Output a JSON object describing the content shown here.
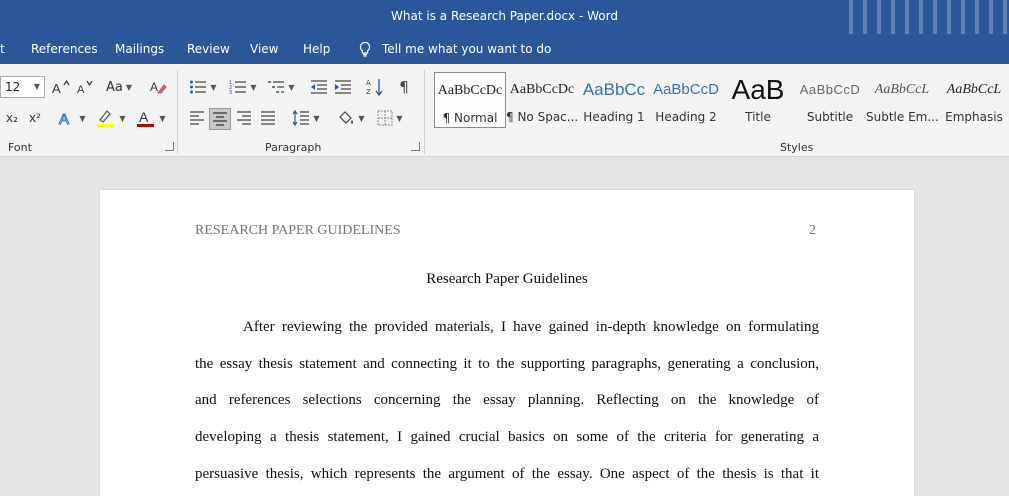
{
  "window": {
    "title": "What is a Research Paper.docx  -  Word"
  },
  "tabs": [
    {
      "label": "t"
    },
    {
      "label": "References"
    },
    {
      "label": "Mailings"
    },
    {
      "label": "Review"
    },
    {
      "label": "View"
    },
    {
      "label": "Help"
    }
  ],
  "tell_me": {
    "label": "Tell me what you want to do"
  },
  "ribbon": {
    "font": {
      "size": "12",
      "change_case_label": "Aa",
      "group_label": "Font",
      "subscript_label": "x₂",
      "superscript_label": "x²",
      "highlight_color": "#ffff00",
      "font_color": "#c00000"
    },
    "paragraph": {
      "group_label": "Paragraph",
      "show_marks_label": "¶"
    },
    "styles": {
      "group_label": "Styles",
      "items": [
        {
          "preview": "AaBbCcDc",
          "name": "¶ Normal"
        },
        {
          "preview": "AaBbCcDc",
          "name": "¶ No Spac..."
        },
        {
          "preview": "AaBbCc",
          "name": "Heading 1"
        },
        {
          "preview": "AaBbCcD",
          "name": "Heading 2"
        },
        {
          "preview": "AaB",
          "name": "Title"
        },
        {
          "preview": "AaBbCcD",
          "name": "Subtitle"
        },
        {
          "preview": "AaBbCcL",
          "name": "Subtle Em..."
        },
        {
          "preview": "AaBbCcL",
          "name": "Emphasis"
        }
      ]
    }
  },
  "document": {
    "header_left": "RESEARCH PAPER GUIDELINES",
    "page_number": "2",
    "title": "Research Paper Guidelines",
    "lines": [
      "After reviewing the provided materials, I have gained in-depth knowledge on formulating",
      "the essay thesis statement and connecting it to the supporting paragraphs, generating a conclusion,",
      "and references selections concerning the essay planning. Reflecting on the knowledge of",
      "developing a thesis statement, I gained crucial basics on some of the criteria for generating a",
      "persuasive thesis, which represents the argument of the essay. One aspect of the thesis is that it"
    ]
  }
}
